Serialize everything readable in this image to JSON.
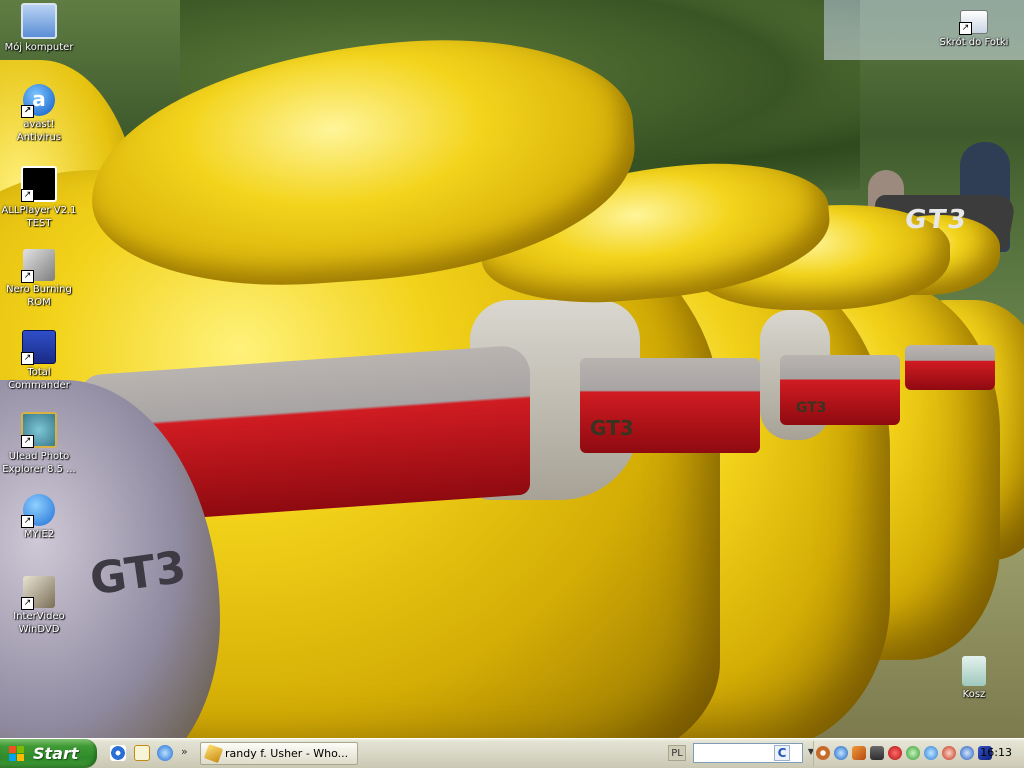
{
  "desktop": {
    "icons": [
      {
        "label_line1": "Mój komputer",
        "label_line2": "",
        "icon": "my-computer-icon"
      },
      {
        "label_line1": "avast!",
        "label_line2": "Antivirus",
        "icon": "avast-icon"
      },
      {
        "label_line1": "ALLPlayer V2.1",
        "label_line2": "TEST",
        "icon": "allplayer-icon"
      },
      {
        "label_line1": "Nero Burning",
        "label_line2": "ROM",
        "icon": "nero-icon"
      },
      {
        "label_line1": "Total",
        "label_line2": "Commander",
        "icon": "total-commander-icon"
      },
      {
        "label_line1": "Ulead Photo",
        "label_line2": "Explorer 8.5 ...",
        "icon": "ulead-photo-icon"
      },
      {
        "label_line1": "MYIE2",
        "label_line2": "",
        "icon": "myie2-icon"
      },
      {
        "label_line1": "InterVideo",
        "label_line2": "WinDVD",
        "icon": "windvd-icon"
      },
      {
        "label_line1": "Skrót do Fotki",
        "label_line2": "",
        "icon": "fotki-shortcut-icon"
      },
      {
        "label_line1": "Kosz",
        "label_line2": "",
        "icon": "recycle-bin-icon"
      }
    ],
    "wallpaper_badges": {
      "gt3": "GT3",
      "gt3_left": "GT3",
      "gt3_small1": "GT3",
      "gt3_small2": "GT3"
    }
  },
  "taskbar": {
    "start_label": "Start",
    "quick_launch": [
      "show-desktop-icon",
      "outlook-express-icon",
      "internet-explorer-icon"
    ],
    "chevron": "»",
    "task_button_label": "randy f. Usher - Who...",
    "language": "PL",
    "search_placeholder": "",
    "search_logo": "C",
    "tray_icons": [
      "back-arrow-icon",
      "network-icon",
      "firewall-icon",
      "monitor-icon",
      "settings-icon",
      "security-icon",
      "antivirus-icon",
      "wifi-icon",
      "update-icon",
      "display-icon"
    ],
    "clock": "16:13"
  },
  "colors": {
    "taskbar_bg": "#d9d8c7",
    "start_green": "#3f9a35",
    "car_yellow": "#f2d21a",
    "taillight_red": "#d01c22"
  }
}
